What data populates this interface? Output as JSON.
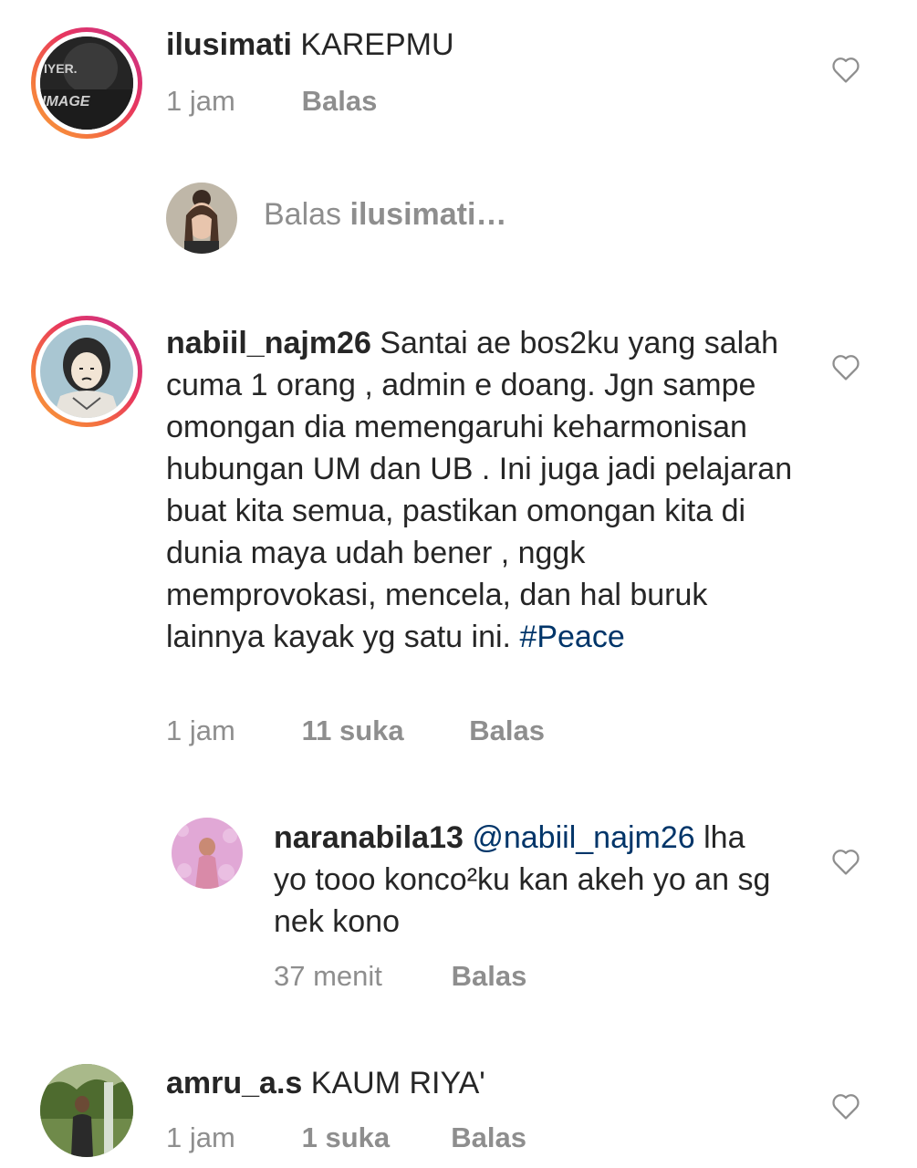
{
  "comments": [
    {
      "username": "ilusimati",
      "text": "KAREPMU",
      "time": "1 jam",
      "likes": "",
      "reply": "Balas"
    },
    {
      "username": "nabiil_najm26",
      "text": "Santai ae bos2ku yang salah cuma 1 orang , admin e doang. Jgn sampe omongan dia memengaruhi keharmonisan hubungan UM dan UB . Ini juga jadi pelajaran buat kita semua, pastikan omongan kita di dunia maya udah bener , nggk memprovokasi, mencela, dan hal buruk lainnya kayak yg satu ini.",
      "hashtag": "#Peace",
      "time": "1 jam",
      "likes": "11 suka",
      "reply": "Balas"
    },
    {
      "username": "naranabila13",
      "mention": "@nabiil_najm26",
      "text": "lha yo tooo konco²ku kan akeh yo an sg nek kono",
      "time": "37 menit",
      "reply": "Balas"
    },
    {
      "username": "amru_a.s",
      "text": "KAUM RIYA'",
      "time": "1 jam",
      "likes": "1 suka",
      "reply": "Balas"
    }
  ],
  "reply_prompt": {
    "prefix": "Balas",
    "username": "ilusimati…"
  },
  "icons": {
    "like": "heart-outline-icon"
  },
  "colors": {
    "text": "#262626",
    "secondary": "#8e8e8e",
    "link": "#003569"
  }
}
